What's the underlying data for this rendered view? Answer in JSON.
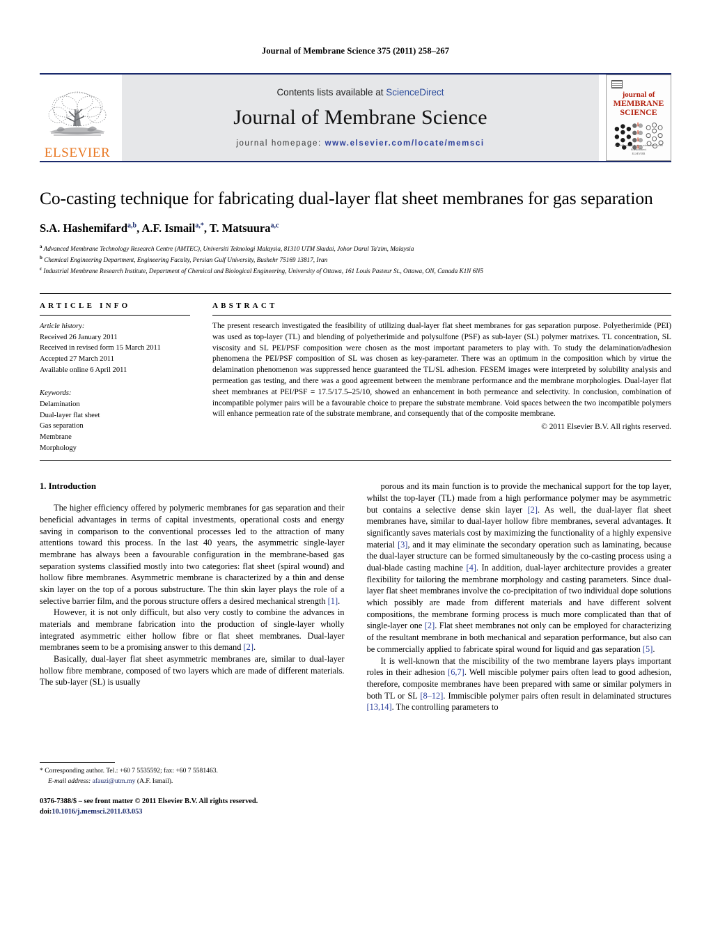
{
  "running_head": "Journal of Membrane Science 375 (2011) 258–267",
  "masthead": {
    "contents_prefix": "Contents lists available at ",
    "contents_link": "ScienceDirect",
    "journal_title": "Journal of Membrane Science",
    "homepage_prefix": "journal homepage:",
    "homepage_url": "www.elsevier.com/locate/memsci",
    "publisher": "ELSEVIER",
    "cover": {
      "line1": "journal of",
      "line2": "MEMBRANE",
      "line3": "SCIENCE",
      "foot1": "Available online at www.sciencedirect.com",
      "foot2": "ScienceDirect",
      "foot3": "ELSEVIER"
    }
  },
  "article": {
    "title": "Co-casting technique for fabricating dual-layer flat sheet membranes for gas separation",
    "authors": [
      {
        "name": "S.A. Hashemifard",
        "marks": "a,b",
        "sep": ", "
      },
      {
        "name": "A.F. Ismail",
        "marks": "a,*",
        "sep": ", "
      },
      {
        "name": "T. Matsuura",
        "marks": "a,c",
        "sep": ""
      }
    ],
    "affiliations": [
      {
        "mark": "a",
        "text": "Advanced Membrane Technology Research Centre (AMTEC), Universiti Teknologi Malaysia, 81310 UTM Skudai, Johor Darul Ta'zim, Malaysia"
      },
      {
        "mark": "b",
        "text": "Chemical Engineering Department, Engineering Faculty, Persian Gulf University, Bushehr 75169 13817, Iran"
      },
      {
        "mark": "c",
        "text": "Industrial Membrane Research Institute, Department of Chemical and Biological Engineering, University of Ottawa, 161 Louis Pasteur St., Ottawa, ON, Canada K1N 6N5"
      }
    ]
  },
  "info": {
    "heading": "ARTICLE INFO",
    "history_label": "Article history:",
    "history": [
      "Received 26 January 2011",
      "Received in revised form 15 March 2011",
      "Accepted 27 March 2011",
      "Available online 6 April 2011"
    ],
    "keywords_label": "Keywords:",
    "keywords": [
      "Delamination",
      "Dual-layer flat sheet",
      "Gas separation",
      "Membrane",
      "Morphology"
    ]
  },
  "abstract": {
    "heading": "ABSTRACT",
    "text": "The present research investigated the feasibility of utilizing dual-layer flat sheet membranes for gas separation purpose. Polyetherimide (PEI) was used as top-layer (TL) and blending of polyetherimide and polysulfone (PSF) as sub-layer (SL) polymer matrixes. TL concentration, SL viscosity and SL PEI/PSF composition were chosen as the most important parameters to play with. To study the delamination/adhesion phenomena the PEI/PSF composition of SL was chosen as key-parameter. There was an optimum in the composition which by virtue the delamination phenomenon was suppressed hence guaranteed the TL/SL adhesion. FESEM images were interpreted by solubility analysis and permeation gas testing, and there was a good agreement between the membrane performance and the membrane morphologies. Dual-layer flat sheet membranes at PEI/PSF = 17.5/17.5–25/10, showed an enhancement in both permeance and selectivity. In conclusion, combination of incompatible polymer pairs will be a favourable choice to prepare the substrate membrane. Void spaces between the two incompatible polymers will enhance permeation rate of the substrate membrane, and consequently that of the composite membrane.",
    "copyright": "© 2011 Elsevier B.V. All rights reserved."
  },
  "body": {
    "section_number_title": "1.  Introduction",
    "left_paragraphs": [
      "The higher efficiency offered by polymeric membranes for gas separation and their beneficial advantages in terms of capital investments, operational costs and energy saving in comparison to the conventional processes led to the attraction of many attentions toward this process. In the last 40 years, the asymmetric single-layer membrane has always been a favourable configuration in the membrane-based gas separation systems classified mostly into two categories: flat sheet (spiral wound) and hollow fibre membranes. Asymmetric membrane is characterized by a thin and dense skin layer on the top of a porous substructure. The thin skin layer plays the role of a selective barrier film, and the porous structure offers a desired mechanical strength [1].",
      "However, it is not only difficult, but also very costly to combine the advances in materials and membrane fabrication into the production of single-layer wholly integrated asymmetric either hollow fibre or flat sheet membranes. Dual-layer membranes seem to be a promising answer to this demand [2].",
      "Basically, dual-layer flat sheet asymmetric membranes are, similar to dual-layer hollow fibre membrane, composed of two layers which are made of different materials. The sub-layer (SL) is usually"
    ],
    "right_paragraphs": [
      "porous and its main function is to provide the mechanical support for the top layer, whilst the top-layer (TL) made from a high performance polymer may be asymmetric but contains a selective dense skin layer [2]. As well, the dual-layer flat sheet membranes have, similar to dual-layer hollow fibre membranes, several advantages. It significantly saves materials cost by maximizing the functionality of a highly expensive material [3], and it may eliminate the secondary operation such as laminating, because the dual-layer structure can be formed simultaneously by the co-casting process using a dual-blade casting machine [4]. In addition, dual-layer architecture provides a greater flexibility for tailoring the membrane morphology and casting parameters. Since dual-layer flat sheet membranes involve the co-precipitation of two individual dope solutions which possibly are made from different materials and have different solvent compositions, the membrane forming process is much more complicated than that of single-layer one [2]. Flat sheet membranes not only can be employed for characterizing of the resultant membrane in both mechanical and separation performance, but also can be commercially applied to fabricate spiral wound for liquid and gas separation [5].",
      "It is well-known that the miscibility of the two membrane layers plays important roles in their adhesion [6,7]. Well miscible polymer pairs often lead to good adhesion, therefore, composite membranes have been prepared with same or similar polymers in both TL or SL [8–12]. Immiscible polymer pairs often result in delaminated structures [13,14]. The controlling parameters to"
    ]
  },
  "footer": {
    "corresponding_mark": "*",
    "corresponding_text": "Corresponding author. Tel.: +60 7 5535592; fax: +60 7 5581463.",
    "email_label": "E-mail address:",
    "email": "afauzi@utm.my",
    "email_owner": "(A.F. Ismail).",
    "issn_line": "0376-7388/$ – see front matter © 2011 Elsevier B.V. All rights reserved.",
    "doi_label": "doi:",
    "doi": "10.1016/j.memsci.2011.03.053"
  },
  "colors": {
    "rule_blue": "#1a2a6c",
    "link_blue": "#2b3f9b",
    "elsevier_orange": "#E87722",
    "cover_red": "#b3210f",
    "band_gray": "#e6e7e9"
  }
}
